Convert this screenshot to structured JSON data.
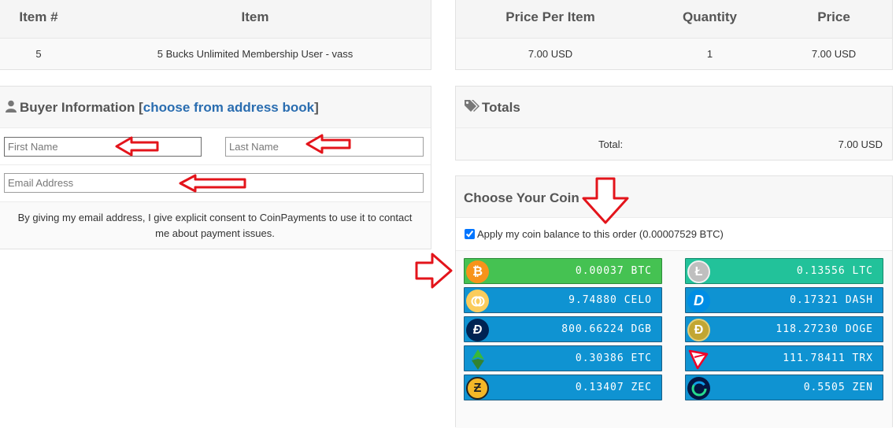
{
  "order_table": {
    "headers": [
      "Item #",
      "Item"
    ],
    "row": {
      "item_no": "5",
      "item": "5 Bucks Unlimited Membership User - vass"
    }
  },
  "price_table": {
    "headers": [
      "Price Per Item",
      "Quantity",
      "Price"
    ],
    "row": {
      "price_per_item": "7.00 USD",
      "quantity": "1",
      "price": "7.00 USD"
    }
  },
  "buyer": {
    "title": "Buyer Information [",
    "link": "choose from address book",
    "title_end": "]",
    "first_name_placeholder": "First Name",
    "last_name_placeholder": "Last Name",
    "email_placeholder": "Email Address",
    "consent_line1": "By giving my email address, I give explicit consent to CoinPayments to use it to contact",
    "consent_line2": "me about payment issues."
  },
  "totals": {
    "title": "Totals",
    "label": "Total:",
    "value": "7.00 USD"
  },
  "coins": {
    "title": "Choose Your Coin",
    "apply_balance_label": "Apply my coin balance to this order (0.00007529 BTC)",
    "apply_balance_checked": true,
    "list": [
      {
        "amount": "0.00037 BTC",
        "icon": "bitcoin-icon",
        "color": "#f7931a",
        "selected": true
      },
      {
        "amount": "0.13556 LTC",
        "icon": "litecoin-icon",
        "color": "#bfbfbf",
        "selected": false
      },
      {
        "amount": "9.74880 CELO",
        "icon": "celo-icon",
        "color": "#fbcc5c",
        "selected": false
      },
      {
        "amount": "0.17321 DASH",
        "icon": "dash-icon",
        "color": "#008de4",
        "selected": false
      },
      {
        "amount": "800.66224 DGB",
        "icon": "digibyte-icon",
        "color": "#002352",
        "selected": false
      },
      {
        "amount": "118.27230 DOGE",
        "icon": "dogecoin-icon",
        "color": "#c2a633",
        "selected": false
      },
      {
        "amount": "0.30386 ETC",
        "icon": "ethereum-classic-icon",
        "color": "#328332",
        "selected": false
      },
      {
        "amount": "111.78411 TRX",
        "icon": "tron-icon",
        "color": "#ef0027",
        "selected": false
      },
      {
        "amount": "0.13407 ZEC",
        "icon": "zcash-icon",
        "color": "#f4b728",
        "selected": false
      },
      {
        "amount": "0.5505 ZEN",
        "icon": "horizen-icon",
        "color": "#041742",
        "selected": false
      }
    ]
  },
  "colors": {
    "link": "#2a6db0",
    "selected_coin": "#45c252",
    "coin_button": "#0f93d2",
    "ltc_button": "#22c29a",
    "annotation_arrow": "#e3141b"
  }
}
